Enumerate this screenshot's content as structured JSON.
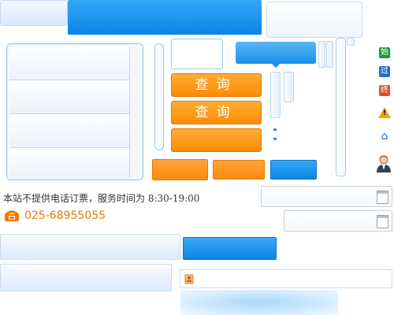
{
  "query_button_label": "查询",
  "query_button_label_2": "查询",
  "notice": "本站不提供电话订票，服务时间为 8:30-19:00",
  "phone": {
    "icon": "phone-icon",
    "number": "025-68955055"
  },
  "side_icons": [
    {
      "name": "start-icon",
      "char": "始",
      "color": "#1a9e3a"
    },
    {
      "name": "via-icon",
      "char": "过",
      "color": "#1f6fd0"
    },
    {
      "name": "end-icon",
      "char": "终",
      "color": "#d8532a"
    },
    {
      "name": "warning-icon",
      "char": "!",
      "color": "#f3a400"
    },
    {
      "name": "home-icon",
      "char": "⌂",
      "color": "#1b6fd3"
    },
    {
      "name": "user-avatar-icon",
      "char": "",
      "color": "#555555"
    }
  ],
  "calendar_icon": "calendar-icon",
  "passenger_icon": "passenger-icon"
}
